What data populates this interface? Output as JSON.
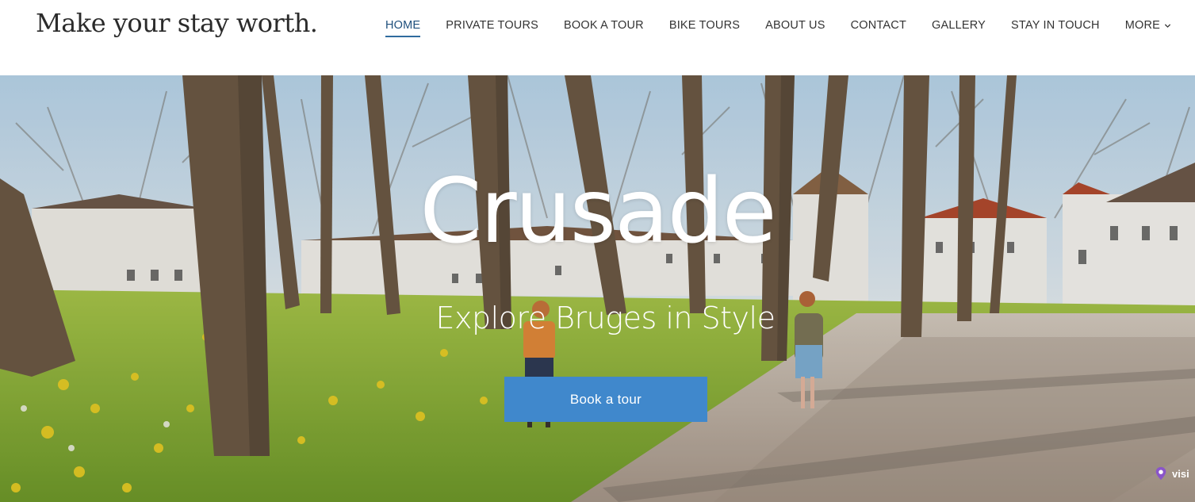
{
  "site": {
    "title": "Make your stay worth."
  },
  "nav": {
    "items": [
      {
        "label": "HOME",
        "active": true
      },
      {
        "label": "PRIVATE TOURS"
      },
      {
        "label": "BOOK A TOUR"
      },
      {
        "label": "BIKE TOURS"
      },
      {
        "label": "ABOUT US"
      },
      {
        "label": "CONTACT"
      },
      {
        "label": "GALLERY"
      },
      {
        "label": "STAY IN TOUCH"
      }
    ],
    "more_label": "MORE",
    "more_icon": "chevron-down-icon"
  },
  "hero": {
    "title": "Crusade",
    "subtitle": "Explore Bruges in Style",
    "cta_label": "Book a tour",
    "cta_color": "#4088cc",
    "image": "tree-lined park with white houses and daffodils, two people walking on cobblestone path"
  },
  "badge": {
    "icon": "location-pin-icon",
    "text": "visi"
  },
  "colors": {
    "nav_active": "#1e4f7c",
    "nav_underline": "#2f6b9e",
    "text": "#333333"
  }
}
